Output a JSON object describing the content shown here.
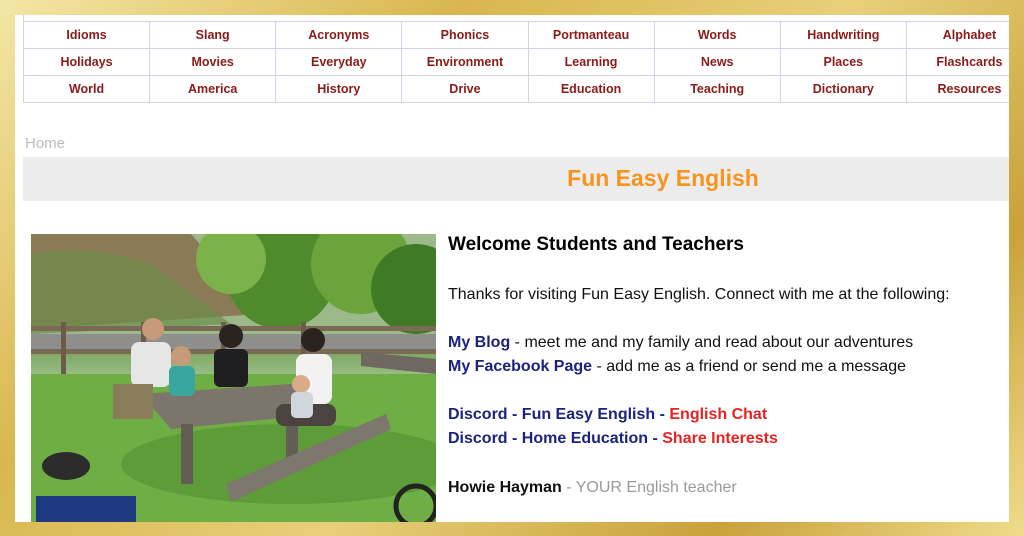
{
  "nav": {
    "rows": [
      [
        "Idioms",
        "Slang",
        "Acronyms",
        "Phonics",
        "Portmanteau",
        "Words",
        "Handwriting",
        "Alphabet"
      ],
      [
        "Holidays",
        "Movies",
        "Everyday",
        "Environment",
        "Learning",
        "News",
        "Places",
        "Flashcards"
      ],
      [
        "World",
        "America",
        "History",
        "Drive",
        "Education",
        "Teaching",
        "Dictionary",
        "Resources"
      ]
    ]
  },
  "breadcrumb": {
    "home": "Home"
  },
  "site_title": "Fun Easy English",
  "intro": {
    "heading": "Welcome Students and Teachers",
    "thanks": "Thanks for visiting Fun Easy English. Connect with me at the following:",
    "blog_link": "My Blog",
    "blog_desc": " - meet me and my family and read about our adventures",
    "facebook_link": "My Facebook Page",
    "facebook_desc": " - add me as a friend or send me a message",
    "discord1_prefix": "Discord - Fun Easy English",
    "discord1_sep": " - ",
    "discord1_link": "English Chat",
    "discord2_prefix": "Discord - Home Education",
    "discord2_sep": " - ",
    "discord2_link": "Share Interests",
    "author_name": "Howie Hayman",
    "author_role": " - YOUR English teacher"
  },
  "colors": {
    "nav_text": "#8b1a1a",
    "title_orange": "#f7941d",
    "link_blue": "#1a237e",
    "link_red": "#e52420"
  }
}
